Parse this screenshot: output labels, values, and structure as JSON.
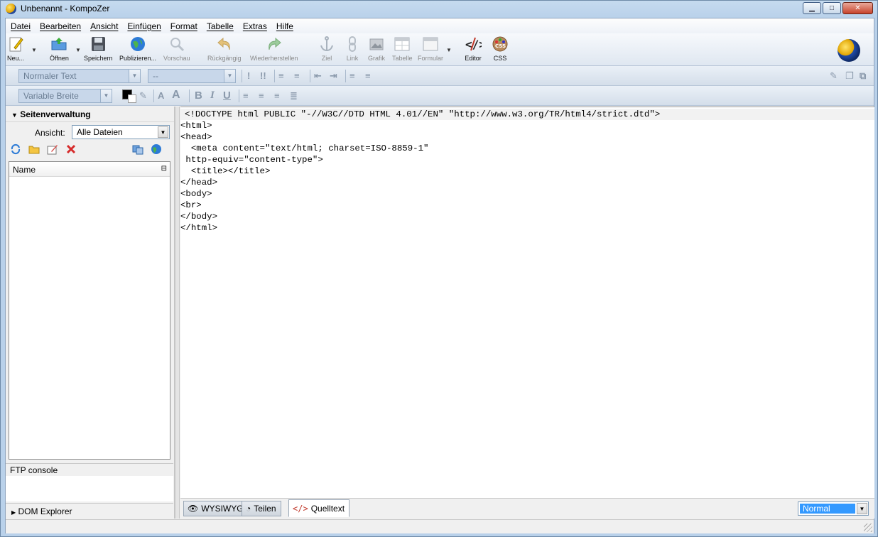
{
  "window": {
    "title": "Unbenannt - KompoZer",
    "btn_min": "▁",
    "btn_max": "□",
    "btn_close": "✕"
  },
  "menu": [
    "Datei",
    "Bearbeiten",
    "Ansicht",
    "Einfügen",
    "Format",
    "Tabelle",
    "Extras",
    "Hilfe"
  ],
  "toolbar": {
    "new": "Neu...",
    "open": "Öffnen",
    "save": "Speichern",
    "publish": "Publizieren...",
    "preview": "Vorschau",
    "undo": "Rückgängig",
    "redo": "Wiederherstellen",
    "anchor": "Ziel",
    "link": "Link",
    "image": "Grafik",
    "table": "Tabelle",
    "form": "Formular",
    "editor": "Editor",
    "css": "CSS"
  },
  "format": {
    "paragraph_style": "Normaler Text",
    "font_size": "--",
    "font_family": "Variable Breite",
    "text_color": "#000000",
    "bg_color": "#ffffff"
  },
  "site_manager": {
    "title": "Seitenverwaltung",
    "view_label": "Ansicht:",
    "view_value": "Alle Dateien",
    "column_name": "Name"
  },
  "ftp": {
    "title": "FTP console"
  },
  "dom": {
    "title": "DOM Explorer"
  },
  "source": [
    "<!DOCTYPE html PUBLIC \"-//W3C//DTD HTML 4.01//EN\" \"http://www.w3.org/TR/html4/strict.dtd\">",
    "<html>",
    "<head>",
    "  <meta content=\"text/html; charset=ISO-8859-1\"",
    " http-equiv=\"content-type\">",
    "  <title></title>",
    "</head>",
    "<body>",
    "<br>",
    "</body>",
    "</html>"
  ],
  "modes": {
    "wysiwyg": "WYSIWYG",
    "split": "Teilen",
    "source": "Quelltext"
  },
  "zoom": {
    "value": "Normal"
  },
  "colors": {
    "accent": "#3399ff",
    "titlebar": "#b9d1ea"
  }
}
